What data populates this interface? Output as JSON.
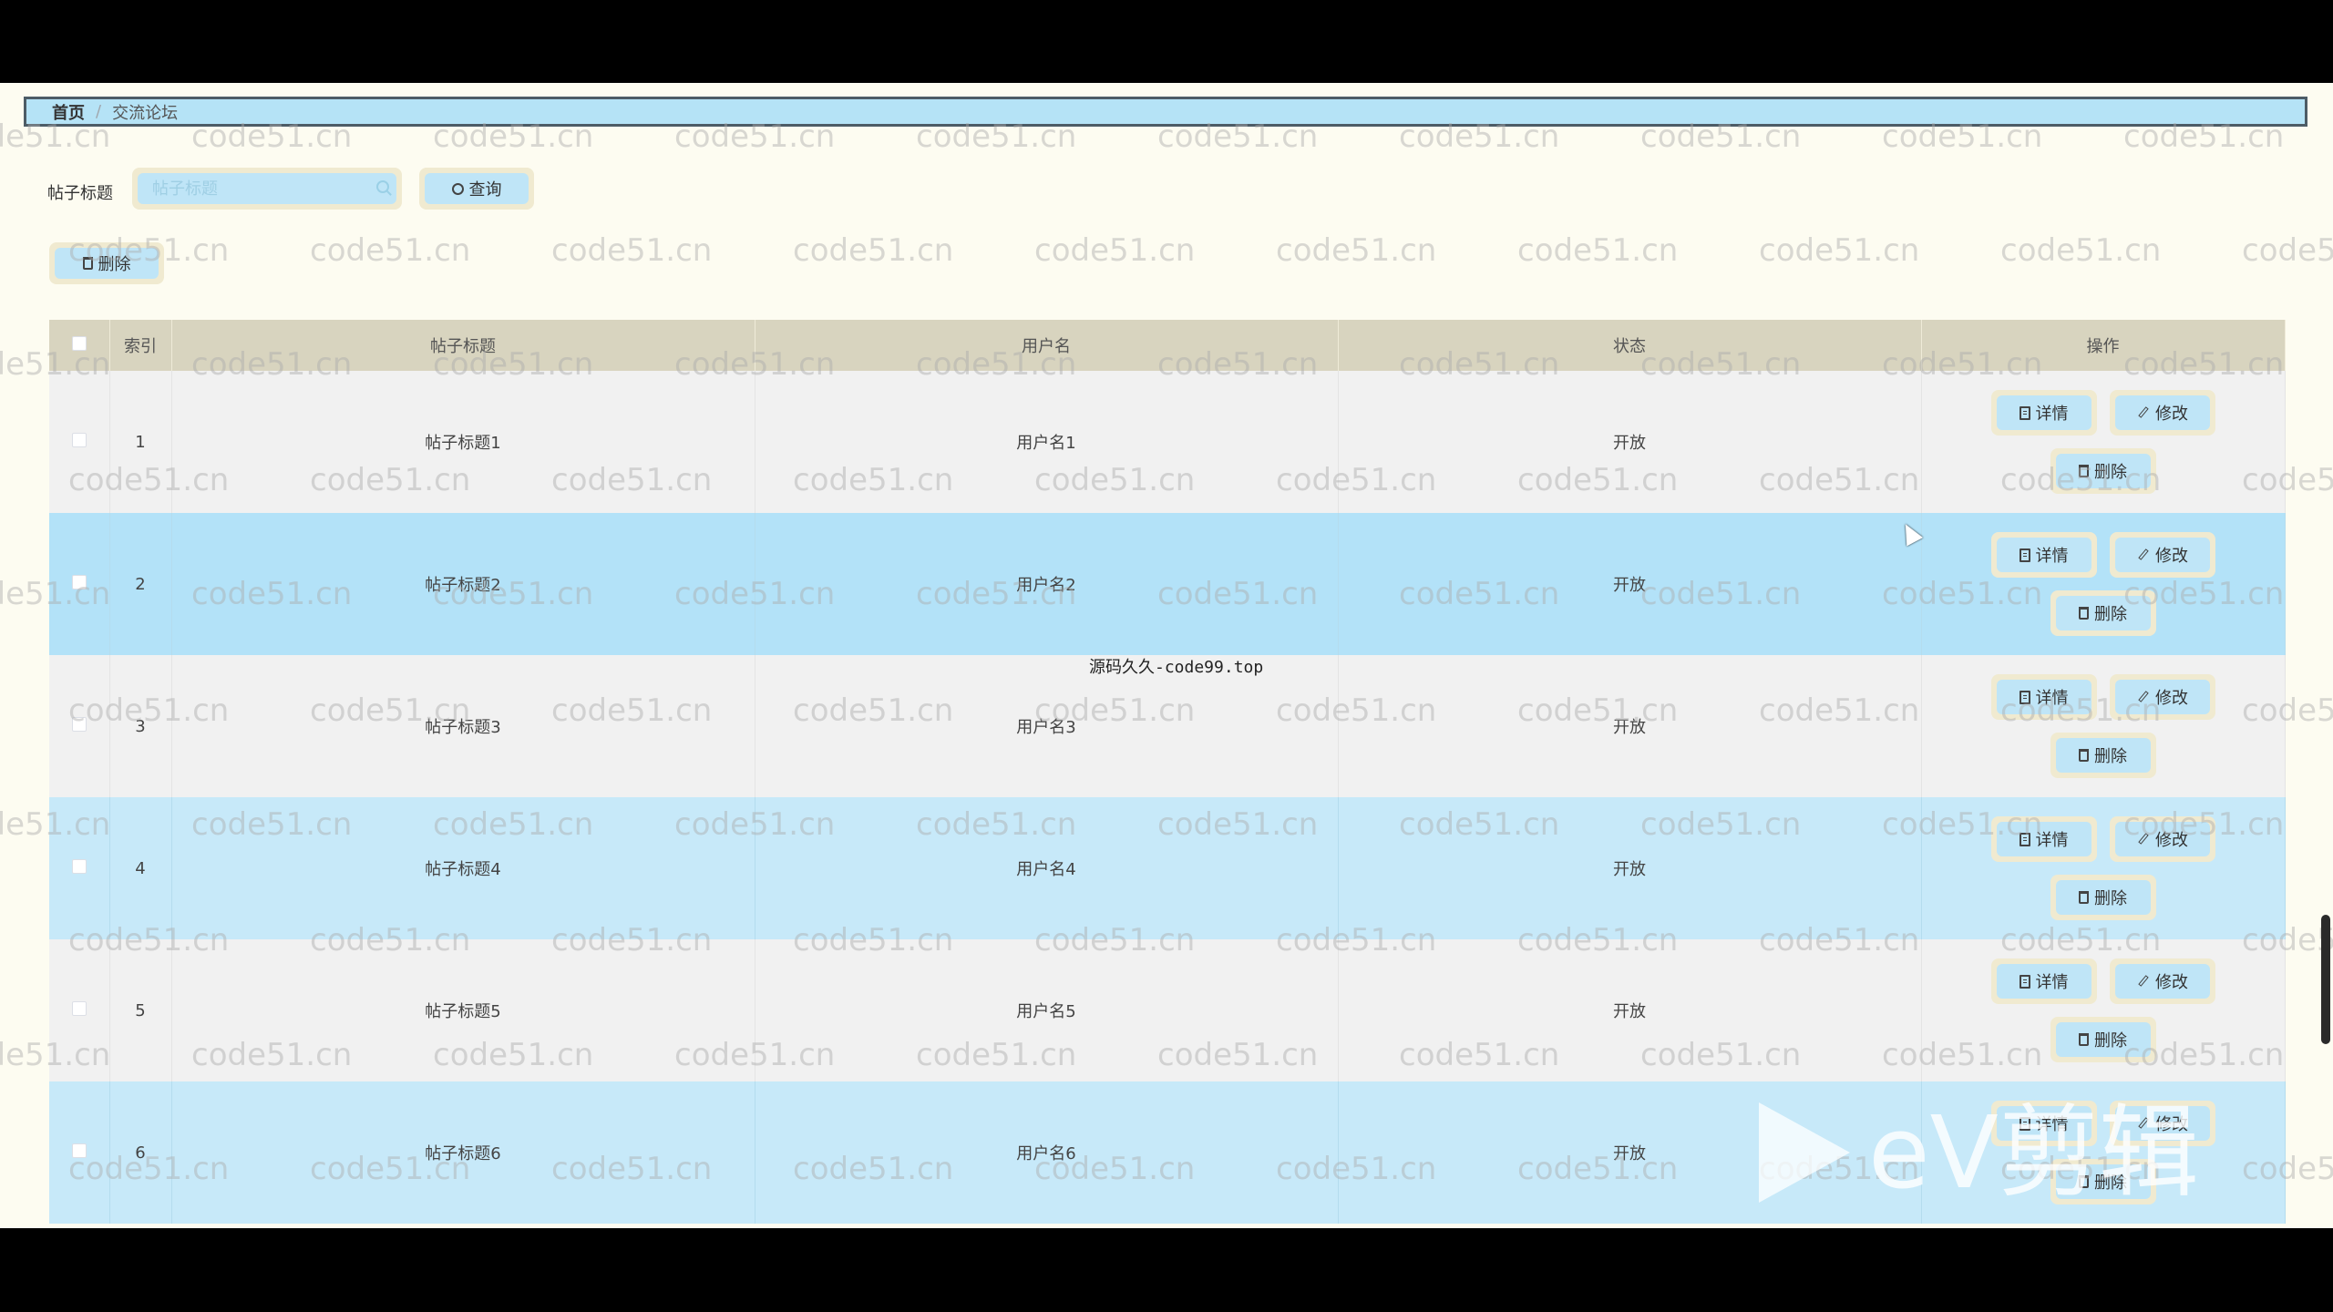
{
  "breadcrumb": {
    "home": "首页",
    "separator": "/",
    "current": "交流论坛"
  },
  "search": {
    "label": "帖子标题",
    "placeholder": "帖子标题",
    "value": "",
    "query_button": "查询"
  },
  "toolbar": {
    "delete_button": "删除"
  },
  "table": {
    "headers": {
      "index": "索引",
      "title": "帖子标题",
      "username": "用户名",
      "status": "状态",
      "actions": "操作"
    },
    "rows": [
      {
        "index": "1",
        "title": "帖子标题1",
        "username": "用户名1",
        "status": "开放"
      },
      {
        "index": "2",
        "title": "帖子标题2",
        "username": "用户名2",
        "status": "开放"
      },
      {
        "index": "3",
        "title": "帖子标题3",
        "username": "用户名3",
        "status": "开放"
      },
      {
        "index": "4",
        "title": "帖子标题4",
        "username": "用户名4",
        "status": "开放"
      },
      {
        "index": "5",
        "title": "帖子标题5",
        "username": "用户名5",
        "status": "开放"
      },
      {
        "index": "6",
        "title": "帖子标题6",
        "username": "用户名6",
        "status": "开放"
      }
    ],
    "row_actions": {
      "detail": "详情",
      "edit": "修改",
      "delete": "删除"
    }
  },
  "overlays": {
    "watermark_text": "code51.cn",
    "center_watermark": "源码久久-code99.top",
    "ev_logo": "eV剪辑"
  },
  "colors": {
    "page_bg": "#fdfcf1",
    "breadcrumb_bg": "#b5e3f6",
    "header_bg": "#d8d4bf",
    "row_odd": "#f1f1f1",
    "row_even": "#c7e9f9",
    "button_outer": "#f0ead0",
    "button_inner": "#bfe5f7"
  }
}
